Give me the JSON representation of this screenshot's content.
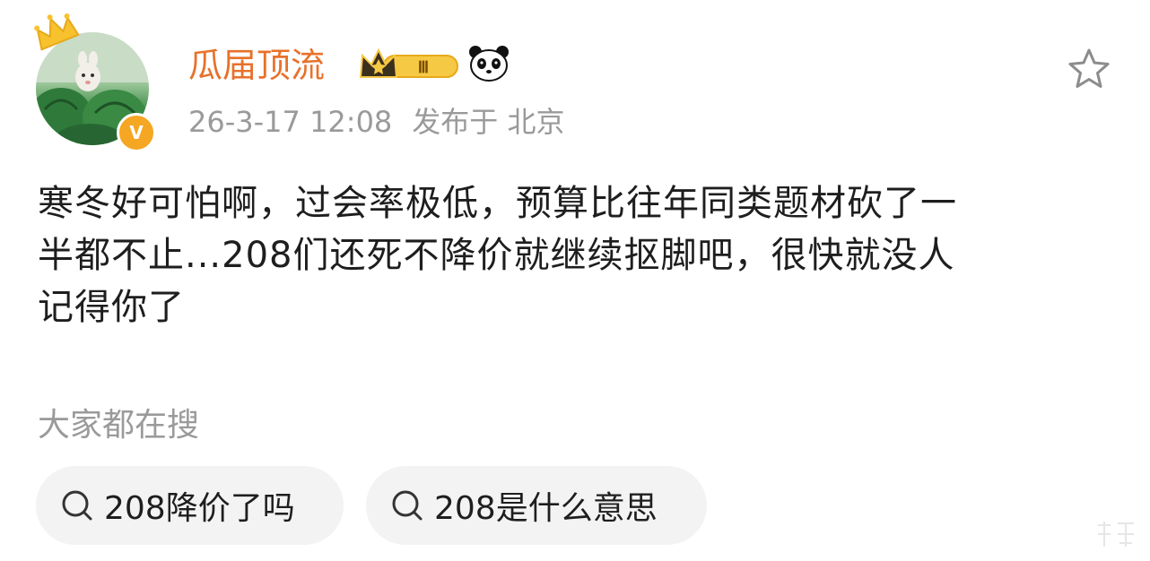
{
  "post": {
    "author": {
      "name": "瓜届顶流",
      "verified_badge": "V",
      "level_badge_text": "Ⅲ"
    },
    "timestamp": "26-3-17 12:08",
    "location": "发布于 北京",
    "body_lines": [
      "寒冬好可怕啊，过会率极低，预算比往年同类题材砍了一",
      "半都不止...208们还死不降价就继续抠脚吧，很快就没人",
      "记得你了"
    ]
  },
  "related": {
    "label": "大家都在搜",
    "items": [
      {
        "text": "208降价了吗"
      },
      {
        "text": "208是什么意思"
      }
    ]
  },
  "colors": {
    "username": "#e8712a",
    "meta": "#9a9a9a",
    "chip_bg": "#f3f3f3",
    "badge_gold": "#f5a623"
  },
  "icons": [
    "crown-icon",
    "verified-v-icon",
    "level-crown-badge-icon",
    "panda-icon",
    "star-icon",
    "search-icon"
  ]
}
